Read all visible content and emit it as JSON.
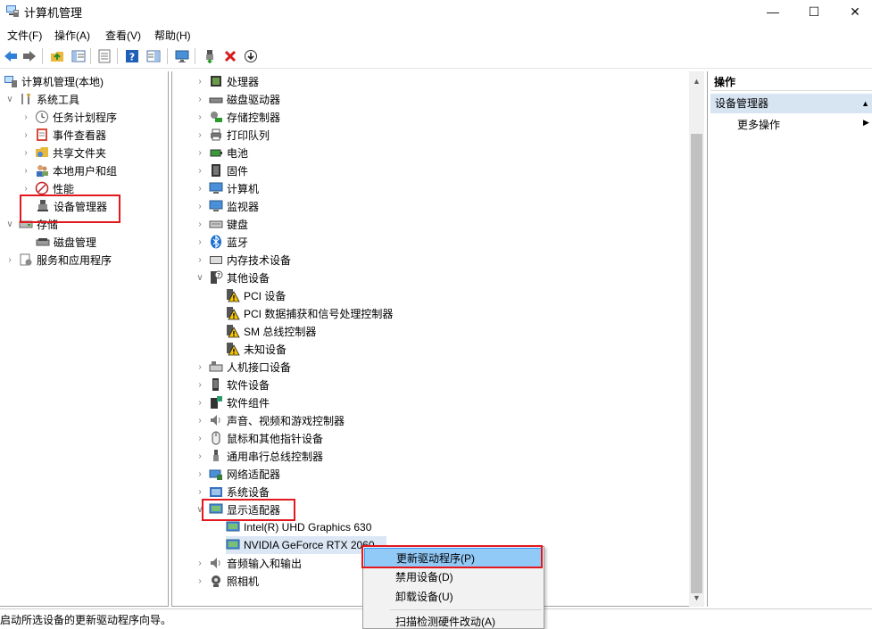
{
  "window": {
    "title": "计算机管理"
  },
  "window_controls": {
    "minimize": "—",
    "maximize": "☐",
    "close": "✕"
  },
  "menu": [
    "文件(F)",
    "操作(A)",
    "查看(V)",
    "帮助(H)"
  ],
  "left_tree": {
    "root": "计算机管理(本地)",
    "system_tools": "系统工具",
    "task_scheduler": "任务计划程序",
    "event_viewer": "事件查看器",
    "shared_folders": "共享文件夹",
    "local_users": "本地用户和组",
    "performance": "性能",
    "device_manager": "设备管理器",
    "storage": "存储",
    "disk_management": "磁盘管理",
    "services_apps": "服务和应用程序"
  },
  "devices": {
    "processors": "处理器",
    "disk_drives": "磁盘驱动器",
    "storage_controllers": "存储控制器",
    "print_queues": "打印队列",
    "batteries": "电池",
    "firmware": "固件",
    "computer": "计算机",
    "monitors": "监视器",
    "keyboards": "键盘",
    "bluetooth": "蓝牙",
    "memory_tech": "内存技术设备",
    "other_devices": "其他设备",
    "pci_device": "PCI 设备",
    "pci_capture": "PCI 数据捕获和信号处理控制器",
    "sm_bus": "SM 总线控制器",
    "unknown_device": "未知设备",
    "hid": "人机接口设备",
    "software_devices": "软件设备",
    "software_components": "软件组件",
    "sound": "声音、视频和游戏控制器",
    "mice": "鼠标和其他指针设备",
    "usb": "通用串行总线控制器",
    "network": "网络适配器",
    "system_devices": "系统设备",
    "display_adapters": "显示适配器",
    "intel_gpu": "Intel(R) UHD Graphics 630",
    "nvidia_gpu": "NVIDIA GeForce RTX 2060",
    "audio_io": "音频输入和输出",
    "cameras": "照相机"
  },
  "actions": {
    "header": "操作",
    "section": "设备管理器",
    "more": "更多操作"
  },
  "context_menu": {
    "update_driver": "更新驱动程序(P)",
    "disable": "禁用设备(D)",
    "uninstall": "卸载设备(U)",
    "scan": "扫描检测硬件改动(A)"
  },
  "status": "启动所选设备的更新驱动程序向导。",
  "colors": {
    "highlight_red": "#e3181e",
    "selection": "#dbe7f5",
    "menu_hover": "#91c9f7",
    "warning": "#f5c400"
  }
}
